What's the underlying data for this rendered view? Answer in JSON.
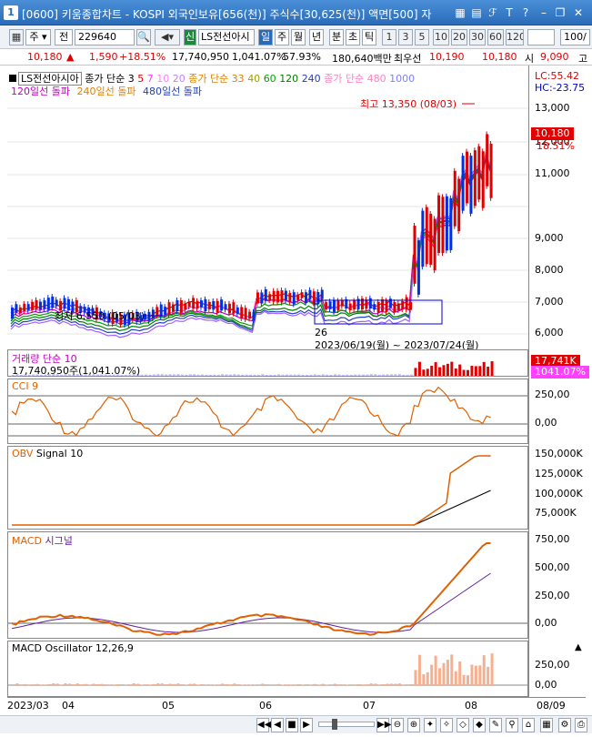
{
  "window": {
    "number": "1",
    "title": "[0600] 키움종합차트 - KOSPI 외국인보유[656(천)] 주식수[30,625(천)] 액면[500] 자",
    "icons": [
      "grid-icon",
      "book-icon",
      "text-icon",
      "question-icon",
      "minimize-icon",
      "restore-icon",
      "close-icon"
    ]
  },
  "toolbar": {
    "market": "주",
    "period_select": "전",
    "code": "229640",
    "stock_name": "LS전선아시",
    "sin_label": "신",
    "periods": [
      "일",
      "주",
      "월",
      "년",
      "분",
      "초",
      "틱"
    ],
    "active_period": "일",
    "intervals": [
      "1",
      "3",
      "5",
      "10",
      "20",
      "30",
      "60",
      "120"
    ],
    "count": "100/"
  },
  "quote": {
    "price": "10,180",
    "arrow": "▲",
    "change": "1,590",
    "change_pct": "+18.51%",
    "volume": "17,740,950",
    "volume_pct": "1,041.07%",
    "ratio": "57.93%",
    "amount": "180,640백만",
    "best_label": "최우선",
    "ask": "10,190",
    "bid": "10,180",
    "open_label": "시",
    "open": "9,090",
    "high_label": "고"
  },
  "price_pane": {
    "name": "LS전선아시아",
    "ma_label": "종가 단순 3",
    "ma_periods": [
      "5",
      "7",
      "10",
      "20"
    ],
    "ma2_label": "종가 단순 33",
    "ma2_periods": [
      "40",
      "60",
      "120",
      "240"
    ],
    "ma3_label": "종가 단순 480",
    "ma3_period": "1000",
    "signals": [
      "120일선 돌파",
      "240일선 돌파",
      "480일선 돌파"
    ],
    "lc": "LC:55.42",
    "hc": "HC:-23.75",
    "high_note": "최고 13,350 (08/03)",
    "low_note": "최저 6,550 (05/03)",
    "range_days": "26",
    "range_note": "2023/06/19(월) ~ 2023/07/24(월)",
    "price_tag": "10,180",
    "pct_tag": "18.51%",
    "axis": [
      "13,000",
      "12,000",
      "11,000",
      "10,000",
      "9,000",
      "8,000",
      "7,000",
      "6,000"
    ],
    "colors": {
      "ma5": "#e00000",
      "ma10": "#ff40ff",
      "ma20": "#c000c0",
      "ma60": "#00a000",
      "ma120": "#008000",
      "ma240": "#2040c0",
      "ma480": "#a060ff"
    }
  },
  "volume_pane": {
    "label": "거래량 단순 10",
    "value": "17,740,950주(1,041.07%)",
    "tag1": "17,741K",
    "tag2": "1041.07%"
  },
  "cci_pane": {
    "label": "CCI 9",
    "axis": [
      "250,00",
      "0,00"
    ]
  },
  "obv_pane": {
    "label": "OBV",
    "signal": "Signal 10",
    "axis": [
      "150,000K",
      "125,000K",
      "100,000K",
      "75,000K"
    ]
  },
  "macd_pane": {
    "label": "MACD",
    "signal": "시그널",
    "axis": [
      "750,00",
      "500,00",
      "250,00",
      "0,00"
    ]
  },
  "osc_pane": {
    "label": "MACD Oscillator 12,26,9",
    "axis": [
      "250,00",
      "0,00"
    ],
    "up_icon": "up-triangle-icon"
  },
  "xaxis": {
    "labels": [
      "2023/03",
      "04",
      "05",
      "06",
      "07",
      "08",
      "08/09"
    ]
  }
}
